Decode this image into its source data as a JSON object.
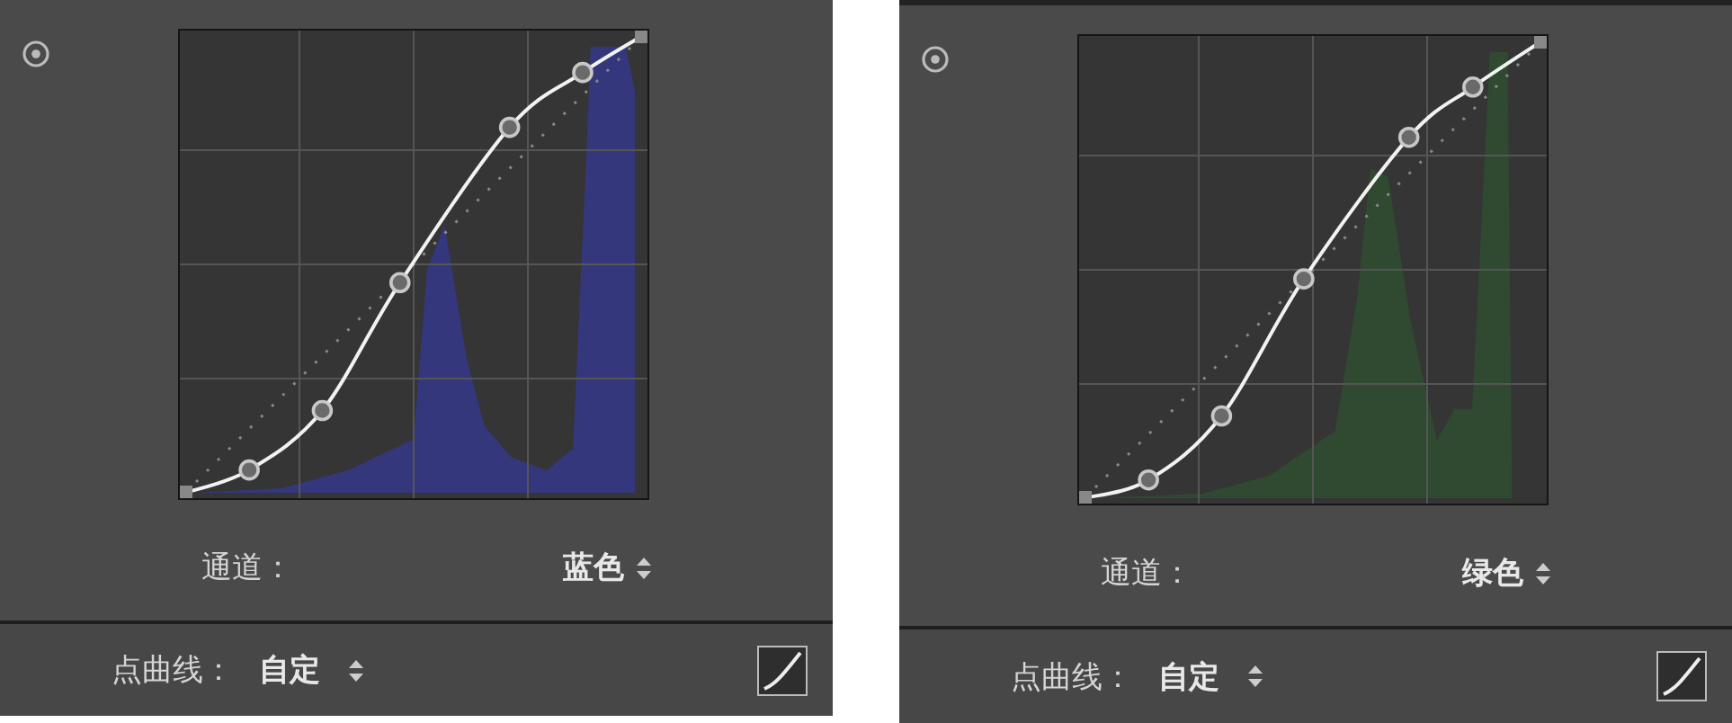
{
  "panels": [
    {
      "histogram": {
        "color": "#34377c"
      },
      "channel": {
        "label": "通道：",
        "value": "蓝色"
      },
      "point_curve": {
        "label": "点曲线：",
        "value": "自定"
      }
    },
    {
      "histogram": {
        "color": "#2f4a30"
      },
      "channel": {
        "label": "通道：",
        "value": "绿色"
      },
      "point_curve": {
        "label": "点曲线：",
        "value": "自定"
      }
    }
  ]
}
